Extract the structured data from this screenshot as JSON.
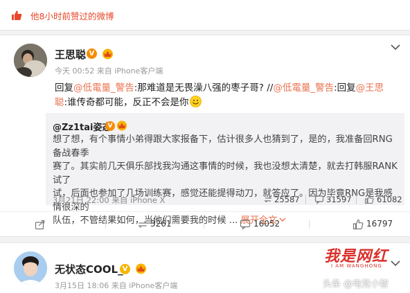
{
  "liked_header": {
    "text": "他8小时前赞过的微博",
    "icon": "thumbs-up-icon"
  },
  "post": {
    "author": "王思聪",
    "verified_badge": "V",
    "meta": "今天 00:52 来自 iPhone客户端",
    "text_parts": {
      "p1": "回复",
      "p2": "@低電量_警告",
      "p3": ":那难道是无畏澡八强的枣子哥? //",
      "p4": "@低電量_警告",
      "p5": ":回复",
      "p6": "@王思",
      "p7": "聪",
      "p8": ":谁传奇都可能，反正不会是你"
    },
    "repost": {
      "user": "@Zz1tai姿态",
      "verified_badge": "V",
      "line1": "想了想，有个事情小弟得跟大家报备下，估计很多人也猜到了，是的，我准备回RNG备战春季",
      "line2": "赛了。其实前几天俱乐部找我沟通这事情的时候，我也没想太清楚，就去打韩服RANK试了",
      "line3": "试，后面也参加了几场训练赛，感觉还能提得动刀，就答应了。因为毕竟RNG是我感情很深的",
      "line4": "队伍，不管结果如何，当他们需要我的时候 ...",
      "more": "展开全文",
      "meta": "3月21日 22:00 来自 iPhone X",
      "reposts": "25587",
      "comments": "31597",
      "likes": "61082"
    },
    "actions": {
      "repost": "3261",
      "comment": "16052",
      "like": "16797"
    }
  },
  "post2": {
    "author": "无状态COOL_",
    "verified_badge": "V",
    "meta": "3月15日 18:06 来自 iPhone客户端"
  },
  "watermarks": {
    "logo": "我是网红",
    "logo_sub": "I AM WANGHONG",
    "source": "头条 @电竞小智"
  },
  "colors": {
    "accent": "#eb7350",
    "orange_badge": "#f78c00"
  }
}
